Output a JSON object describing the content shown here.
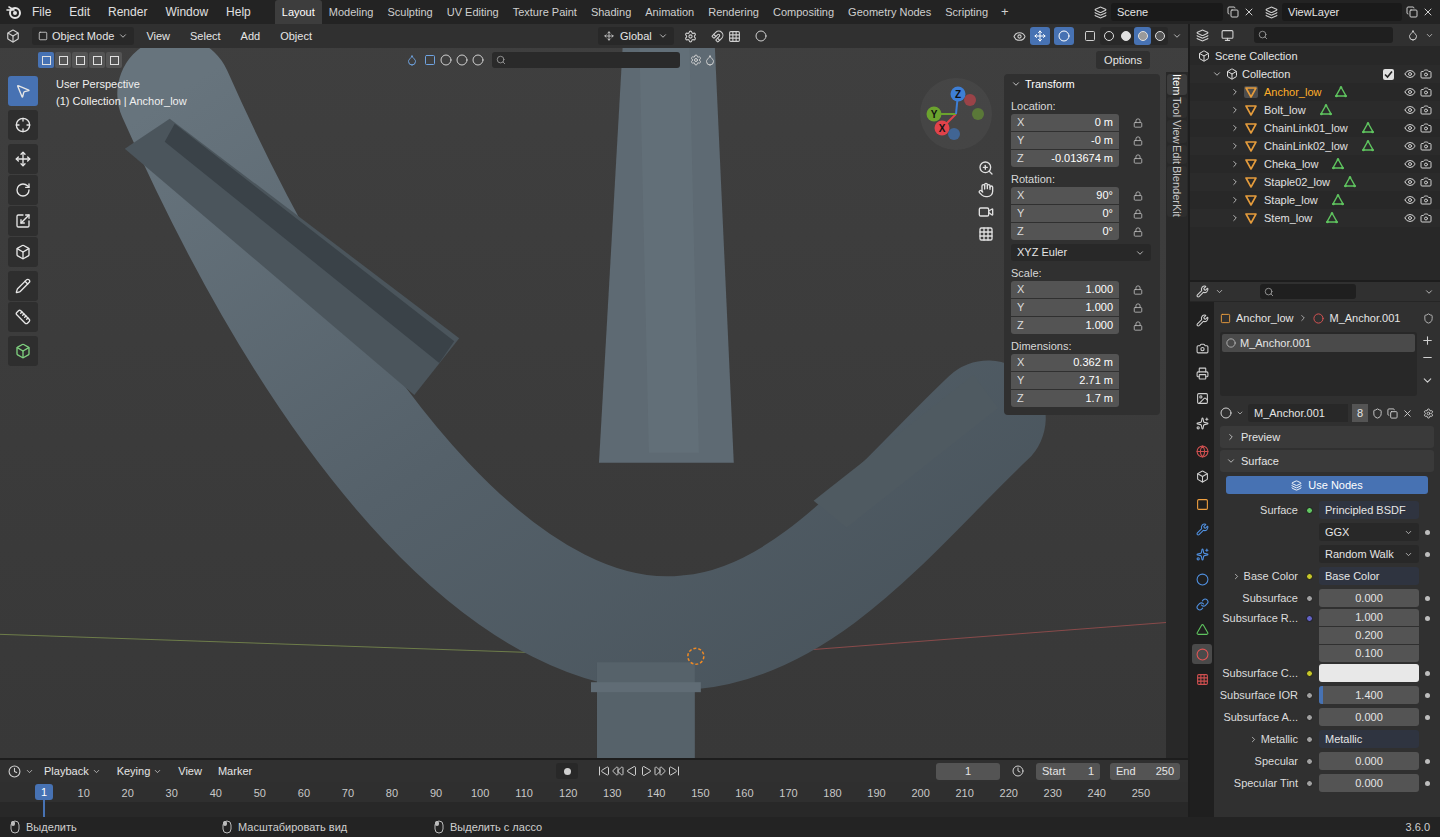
{
  "topbar": {
    "menus": [
      "File",
      "Edit",
      "Render",
      "Window",
      "Help"
    ],
    "workspaces": [
      {
        "label": "Layout",
        "selected": true
      },
      {
        "label": "Modeling",
        "selected": false
      },
      {
        "label": "Sculpting",
        "selected": false
      },
      {
        "label": "UV Editing",
        "selected": false
      },
      {
        "label": "Texture Paint",
        "selected": false
      },
      {
        "label": "Shading",
        "selected": false
      },
      {
        "label": "Animation",
        "selected": false
      },
      {
        "label": "Rendering",
        "selected": false
      },
      {
        "label": "Compositing",
        "selected": false
      },
      {
        "label": "Geometry Nodes",
        "selected": false
      },
      {
        "label": "Scripting",
        "selected": false
      }
    ],
    "add_workspace": "+",
    "scene": "Scene",
    "view_layer": "ViewLayer"
  },
  "viewport": {
    "mode": "Object Mode",
    "menus": [
      "View",
      "Select",
      "Add",
      "Object"
    ],
    "orientation": "Global",
    "select_modes": [
      {
        "selected": true
      },
      {
        "selected": false
      },
      {
        "selected": false
      },
      {
        "selected": false
      },
      {
        "selected": false
      }
    ],
    "shading": [
      {
        "selected": false
      },
      {
        "selected": false
      },
      {
        "selected": true
      },
      {
        "selected": false
      }
    ],
    "options": "Options",
    "view_name": "User Perspective",
    "context": "(1) Collection | Anchor_low",
    "tools": [
      {
        "selected": true
      },
      {
        "selected": false
      },
      {
        "selected": false
      },
      {
        "selected": false
      },
      {
        "selected": false
      },
      {
        "selected": false
      },
      {
        "selected": false
      },
      {
        "selected": false
      },
      {
        "selected": false
      }
    ],
    "gizmo_axes": [
      {
        "label": "X",
        "color": "#e0424a"
      },
      {
        "label": "Y",
        "color": "#6ba32e"
      },
      {
        "label": "Z",
        "color": "#3e7fd6"
      }
    ]
  },
  "sidebar": {
    "tabs": [
      {
        "label": "Item",
        "selected": true
      },
      {
        "label": "Tool",
        "selected": false
      },
      {
        "label": "View",
        "selected": false
      },
      {
        "label": "Edit",
        "selected": false
      },
      {
        "label": "BlenderKit",
        "selected": false
      }
    ],
    "panel": "Transform",
    "groups": [
      {
        "label": "Location:",
        "locks": true,
        "fields": [
          {
            "axis": "X",
            "value": "0 m"
          },
          {
            "axis": "Y",
            "value": "-0 m"
          },
          {
            "axis": "Z",
            "value": "-0.013674 m"
          }
        ]
      },
      {
        "label": "Rotation:",
        "locks": true,
        "mode": "XYZ Euler",
        "fields": [
          {
            "axis": "X",
            "value": "90°"
          },
          {
            "axis": "Y",
            "value": "0°"
          },
          {
            "axis": "Z",
            "value": "0°"
          }
        ]
      },
      {
        "label": "Scale:",
        "locks": true,
        "fields": [
          {
            "axis": "X",
            "value": "1.000"
          },
          {
            "axis": "Y",
            "value": "1.000"
          },
          {
            "axis": "Z",
            "value": "1.000"
          }
        ]
      },
      {
        "label": "Dimensions:",
        "locks": false,
        "fields": [
          {
            "axis": "X",
            "value": "0.362 m"
          },
          {
            "axis": "Y",
            "value": "2.71 m"
          },
          {
            "axis": "Z",
            "value": "1.7 m"
          }
        ]
      }
    ]
  },
  "timeline": {
    "menus": [
      "Playback",
      "Keying",
      "View",
      "Marker"
    ],
    "current_frame": "1",
    "start_label": "Start",
    "start": "1",
    "end_label": "End",
    "end": "250",
    "playhead": "1",
    "ticks": [
      "10",
      "20",
      "30",
      "40",
      "50",
      "60",
      "70",
      "80",
      "90",
      "100",
      "110",
      "120",
      "130",
      "140",
      "150",
      "160",
      "170",
      "180",
      "190",
      "200",
      "210",
      "220",
      "230",
      "240",
      "250"
    ]
  },
  "status_bar": {
    "hints": [
      "Выделить",
      "Масштабировать вид",
      "Выделить с лассо"
    ],
    "version": "3.6.0"
  },
  "outliner": {
    "root": "Scene Collection",
    "collection": {
      "name": "Collection",
      "checked": true
    },
    "objects": [
      {
        "name": "Anchor_low",
        "selected": true
      },
      {
        "name": "Bolt_low",
        "selected": false
      },
      {
        "name": "ChainLink01_low",
        "selected": false
      },
      {
        "name": "ChainLink02_low",
        "selected": false
      },
      {
        "name": "Cheka_low",
        "selected": false
      },
      {
        "name": "Staple02_low",
        "selected": false
      },
      {
        "name": "Staple_low",
        "selected": false
      },
      {
        "name": "Stem_low",
        "selected": false
      }
    ]
  },
  "properties": {
    "tabs": [
      {
        "selected": false
      },
      {
        "selected": false
      },
      {
        "selected": false
      },
      {
        "selected": false
      },
      {
        "selected": false
      },
      {
        "selected": false
      },
      {
        "selected": false
      },
      {
        "selected": false
      },
      {
        "selected": false
      },
      {
        "selected": false
      },
      {
        "selected": false
      },
      {
        "selected": false
      },
      {
        "selected": false
      },
      {
        "selected": true
      },
      {
        "selected": false
      }
    ],
    "breadcrumb": [
      "Anchor_low",
      "M_Anchor.001"
    ],
    "slots": [
      {
        "name": "M_Anchor.001",
        "selected": true
      }
    ],
    "material": {
      "name": "M_Anchor.001",
      "users": "8"
    },
    "panels": [
      {
        "label": "Preview",
        "expanded": false
      },
      {
        "label": "Surface",
        "expanded": true
      }
    ],
    "use_nodes": "Use Nodes",
    "rows": [
      {
        "kind": "link",
        "label": "Surface",
        "value": "Principled BSDF",
        "expandable": false,
        "socket": "#63c763"
      },
      {
        "kind": "dropdown",
        "value": "GGX"
      },
      {
        "kind": "dropdown",
        "value": "Random Walk"
      },
      {
        "kind": "link",
        "label": "Base Color",
        "value": "Base Color",
        "expandable": true,
        "socket": "#c7c729"
      },
      {
        "kind": "slider",
        "label": "Subsurface",
        "value": "0.000",
        "level": 0,
        "socket": "#a1a1a1"
      },
      {
        "kind": "vector",
        "label": "Subsurface R...",
        "values": [
          "1.000",
          "0.200",
          "0.100"
        ],
        "socket": "#6363c7"
      },
      {
        "kind": "color",
        "label": "Subsurface C...",
        "color": "#e8e8e8",
        "socket": "#c7c729"
      },
      {
        "kind": "slider",
        "label": "Subsurface IOR",
        "value": "1.400",
        "level": 0.04,
        "socket": "#a1a1a1"
      },
      {
        "kind": "slider",
        "label": "Subsurface A...",
        "value": "0.000",
        "level": 0,
        "socket": "#a1a1a1"
      },
      {
        "kind": "link",
        "label": "Metallic",
        "value": "Metallic",
        "expandable": true,
        "socket": "#a1a1a1"
      },
      {
        "kind": "slider",
        "label": "Specular",
        "value": "0.000",
        "level": 0,
        "socket": "#a1a1a1"
      },
      {
        "kind": "slider",
        "label": "Specular Tint",
        "value": "0.000",
        "level": 0,
        "socket": "#a1a1a1"
      }
    ]
  }
}
